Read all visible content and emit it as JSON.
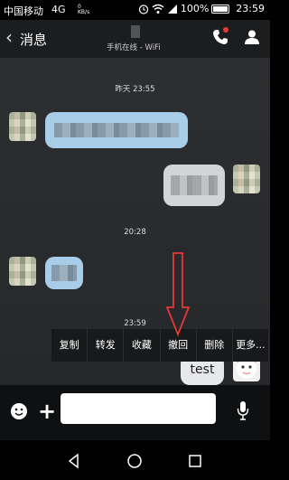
{
  "status_bar": {
    "carrier": "中国移动",
    "network": "4G",
    "speed": "0 KB/s",
    "battery": "100%",
    "time": "23:59"
  },
  "header": {
    "back_label": "消息",
    "subtitle": "手机在线 - WiFi"
  },
  "chat": {
    "timestamps": [
      "昨天 23:55",
      "20:28",
      "23:59"
    ],
    "last_message": "test"
  },
  "context_menu": {
    "items": [
      "复制",
      "转发",
      "收藏",
      "撤回",
      "删除",
      "更多..."
    ]
  },
  "input": {
    "placeholder": ""
  },
  "colors": {
    "background": "#2a2c2f",
    "incoming_bubble": "#a7cde8",
    "outgoing_bubble": "#d2d4d6",
    "accent_red": "#e53935"
  }
}
